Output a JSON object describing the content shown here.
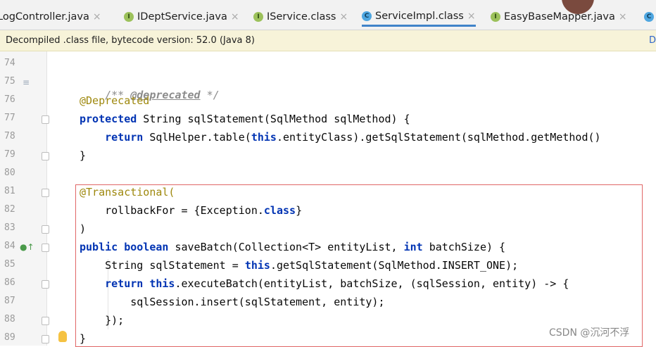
{
  "tabs": [
    {
      "label": "LogController.java",
      "icon": "class-icon",
      "active": false
    },
    {
      "label": "IDeptService.java",
      "icon": "interface-icon",
      "active": false
    },
    {
      "label": "IService.class",
      "icon": "interface-icon",
      "active": false
    },
    {
      "label": "ServiceImpl.class",
      "icon": "class-icon",
      "active": true
    },
    {
      "label": "EasyBaseMapper.java",
      "icon": "interface-icon",
      "active": false
    }
  ],
  "tab_close": "×",
  "icon_letters": {
    "interface": "I",
    "class": "C"
  },
  "banner": {
    "text": "Decompiled .class file, bytecode version: 52.0 (Java 8)",
    "link": "D"
  },
  "line_numbers": [
    "74",
    "75",
    "76",
    "77",
    "78",
    "79",
    "80",
    "81",
    "82",
    "83",
    "84",
    "85",
    "86",
    "87",
    "88",
    "89"
  ],
  "code_lines": [
    "",
    "/** @deprecated */",
    "@Deprecated",
    "protected String sqlStatement(SqlMethod sqlMethod) {",
    "    return SqlHelper.table(this.entityClass).getSqlStatement(sqlMethod.getMethod()",
    "}",
    "",
    "@Transactional(",
    "    rollbackFor = {Exception.class}",
    ")",
    "public boolean saveBatch(Collection<T> entityList, int batchSize) {",
    "    String sqlStatement = this.getSqlStatement(SqlMethod.INSERT_ONE);",
    "    return this.executeBatch(entityList, batchSize, (sqlSession, entity) -> {",
    "        sqlSession.insert(sqlStatement, entity);",
    "    });",
    "}"
  ],
  "watermark": "CSDN @沉河不浮",
  "colors": {
    "keyword": "#0033b3",
    "comment": "#8c8c8c",
    "annotation": "#9e880d",
    "highlight_box": "#e06666",
    "banner_bg": "#f7f3d9"
  }
}
